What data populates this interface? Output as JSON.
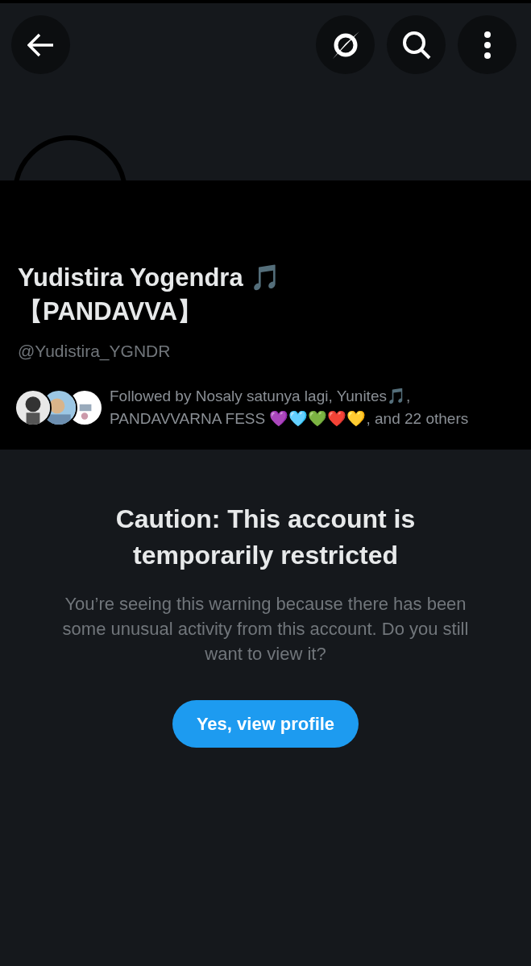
{
  "profile": {
    "name": "Yudistira Yogendra 🎵 【PANDAVVA】",
    "handle": "@Yudistira_YGNDR",
    "followed_by": "Followed by Nosaly satunya lagi, Yunites🎵, PANDAVVARNA FESS 💜🩵💚❤️💛, and 22 others"
  },
  "warning": {
    "title": "Caution: This account is temporarily restricted",
    "body": "You’re seeing this warning because there has been some unusual activity from this account. Do you still want to view it?",
    "button": "Yes, view profile"
  }
}
